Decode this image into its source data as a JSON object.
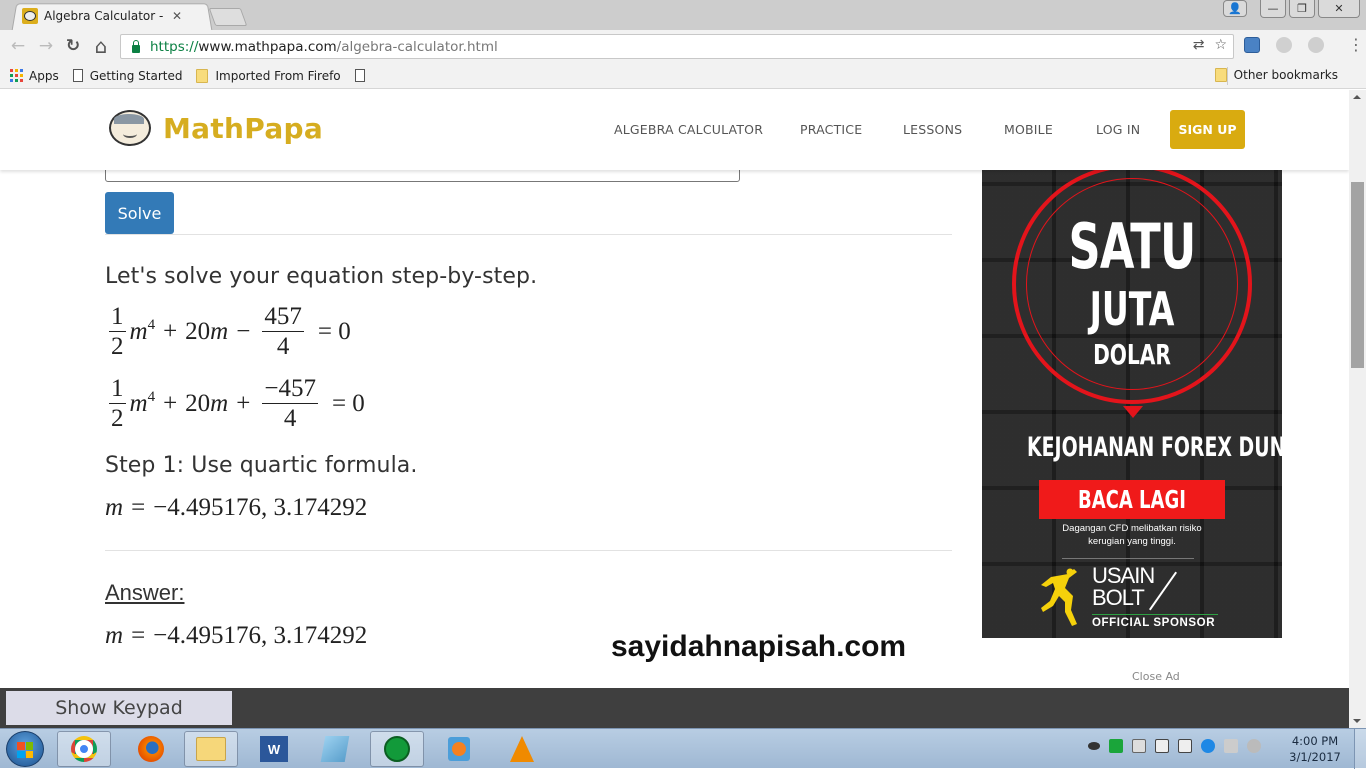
{
  "browser": {
    "tab": {
      "title": "Algebra Calculator - Math",
      "close_glyph": "✕"
    },
    "window_controls": {
      "profile": "👤",
      "minimize": "—",
      "restore": "❐",
      "close": "✕"
    },
    "nav": {
      "back": "←",
      "forward": "→",
      "reload": "↻",
      "home": "⌂"
    },
    "url": {
      "scheme": "https://",
      "host": "www.mathpapa.com",
      "path": "/algebra-calculator.html"
    },
    "omnibox_icons": {
      "translate": "⇄",
      "bookmark_star": "☆"
    },
    "menu": "⋮",
    "bookmarks": {
      "apps": "Apps",
      "items": [
        {
          "label": "Getting Started",
          "icon": "page-icon"
        },
        {
          "label": "Imported From Firefo",
          "icon": "folder-icon"
        },
        {
          "label": "",
          "icon": "page-icon"
        }
      ],
      "other": "Other bookmarks"
    }
  },
  "site": {
    "logo_text": "MathPapa",
    "nav": [
      {
        "label": "ALGEBRA CALCULATOR"
      },
      {
        "label": "PRACTICE"
      },
      {
        "label": "LESSONS"
      },
      {
        "label": "MOBILE"
      },
      {
        "label": "LOG IN"
      }
    ],
    "signup": "SIGN UP",
    "brand_color": "#d9ab10"
  },
  "solver": {
    "input_value": "",
    "solve_label": "Solve",
    "intro": "Let's solve your equation step-by-step.",
    "eq1": {
      "a_num": "1",
      "a_den": "2",
      "var": "m",
      "exp": "4",
      "op1": "+",
      "term2": "20",
      "op2": "−",
      "c_num": "457",
      "c_den": "4",
      "rhs": "= 0"
    },
    "eq2": {
      "a_num": "1",
      "a_den": "2",
      "var": "m",
      "exp": "4",
      "op1": "+",
      "term2": "20",
      "op2": "+",
      "c_num": "−457",
      "c_den": "4",
      "rhs": "= 0"
    },
    "step1": "Step 1: Use quartic formula.",
    "step1_result": {
      "var": "m",
      "eq": "=",
      "values": "−4.495176, 3.174292"
    },
    "answer_label": "Answer:",
    "answer": {
      "var": "m",
      "eq": "=",
      "values": "−4.495176, 3.174292"
    }
  },
  "watermark": "sayidahnapisah.com",
  "ad": {
    "line1": "SATU",
    "line2": "JUTA",
    "line3": "DOLAR",
    "headline": "KEJOHANAN FOREX DUNIA",
    "cta": "BACA LAGI",
    "disclaimer_1": "Dagangan CFD melibatkan risiko",
    "disclaimer_2": "kerugian yang tinggi.",
    "brand_1": "USAIN",
    "brand_2": "BOLT",
    "sponsor": "OFFICIAL SPONSOR",
    "close": "Close Ad",
    "accent": "#e3141b"
  },
  "keypad": {
    "label": "Show Keypad"
  },
  "taskbar": {
    "apps": [
      "Chrome",
      "Firefox",
      "Windows Explorer",
      "Microsoft Word",
      "Notepad",
      "Network",
      "Media Player",
      "VLC"
    ],
    "clock_time": "4:00 PM",
    "clock_date": "3/1/2017"
  }
}
